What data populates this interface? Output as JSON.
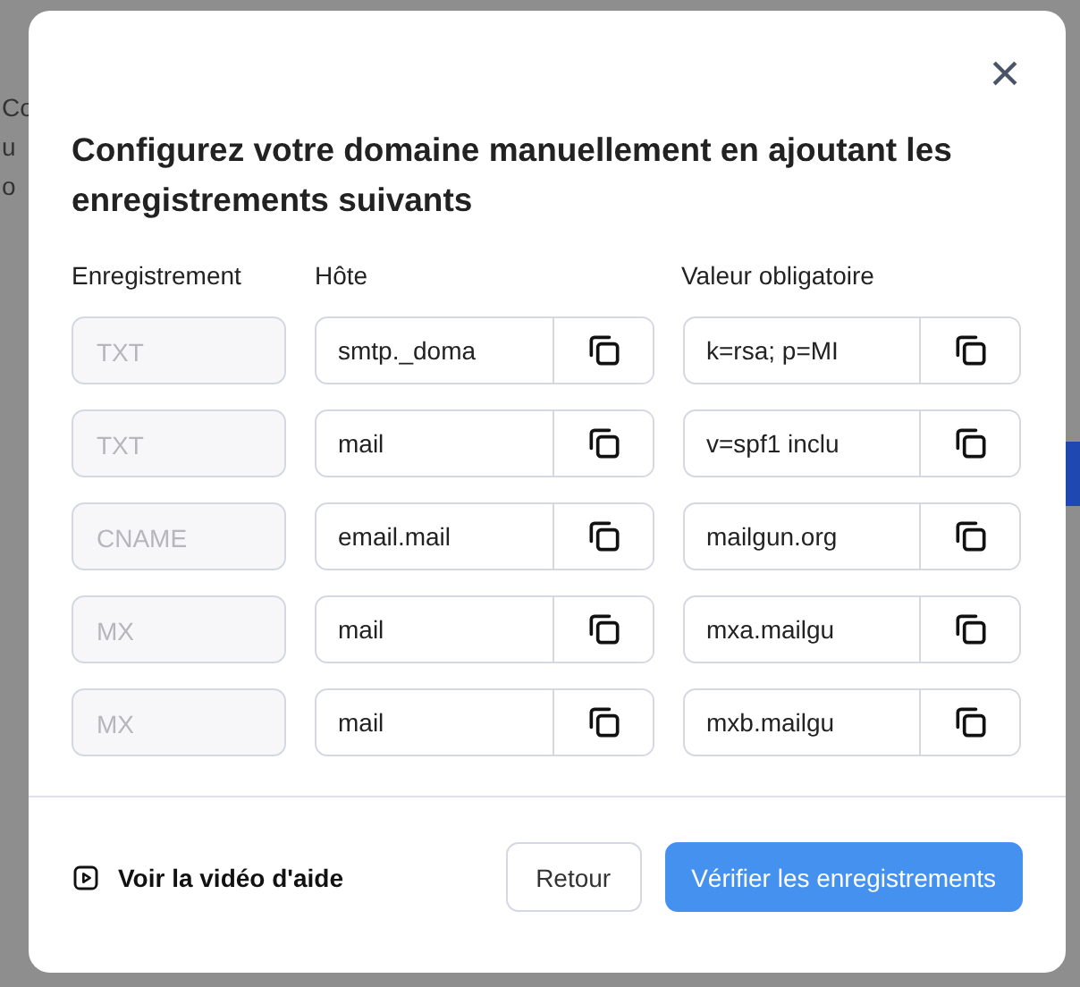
{
  "background": {
    "texts": [
      "Co",
      "u",
      "o"
    ]
  },
  "dialog": {
    "close": "×",
    "title": "Configurez votre domaine manuellement en ajoutant les enregistrements suivants",
    "columns": [
      "Enregistrement",
      "Hôte",
      "Valeur obligatoire"
    ],
    "rows": [
      {
        "type": "TXT",
        "host": "smtp._doma",
        "value": "k=rsa; p=MI"
      },
      {
        "type": "TXT",
        "host": "mail",
        "value": "v=spf1 inclu"
      },
      {
        "type": "CNAME",
        "host": "email.mail",
        "value": "mailgun.org"
      },
      {
        "type": "MX",
        "host": "mail",
        "value": "mxa.mailgu"
      },
      {
        "type": "MX",
        "host": "mail",
        "value": "mxb.mailgu"
      }
    ],
    "help_link": "Voir la vidéo d'aide",
    "buttons": [
      {
        "label": "Retour",
        "kind": "secondary"
      },
      {
        "label": "Vérifier les enregistrements",
        "kind": "primary"
      }
    ]
  }
}
